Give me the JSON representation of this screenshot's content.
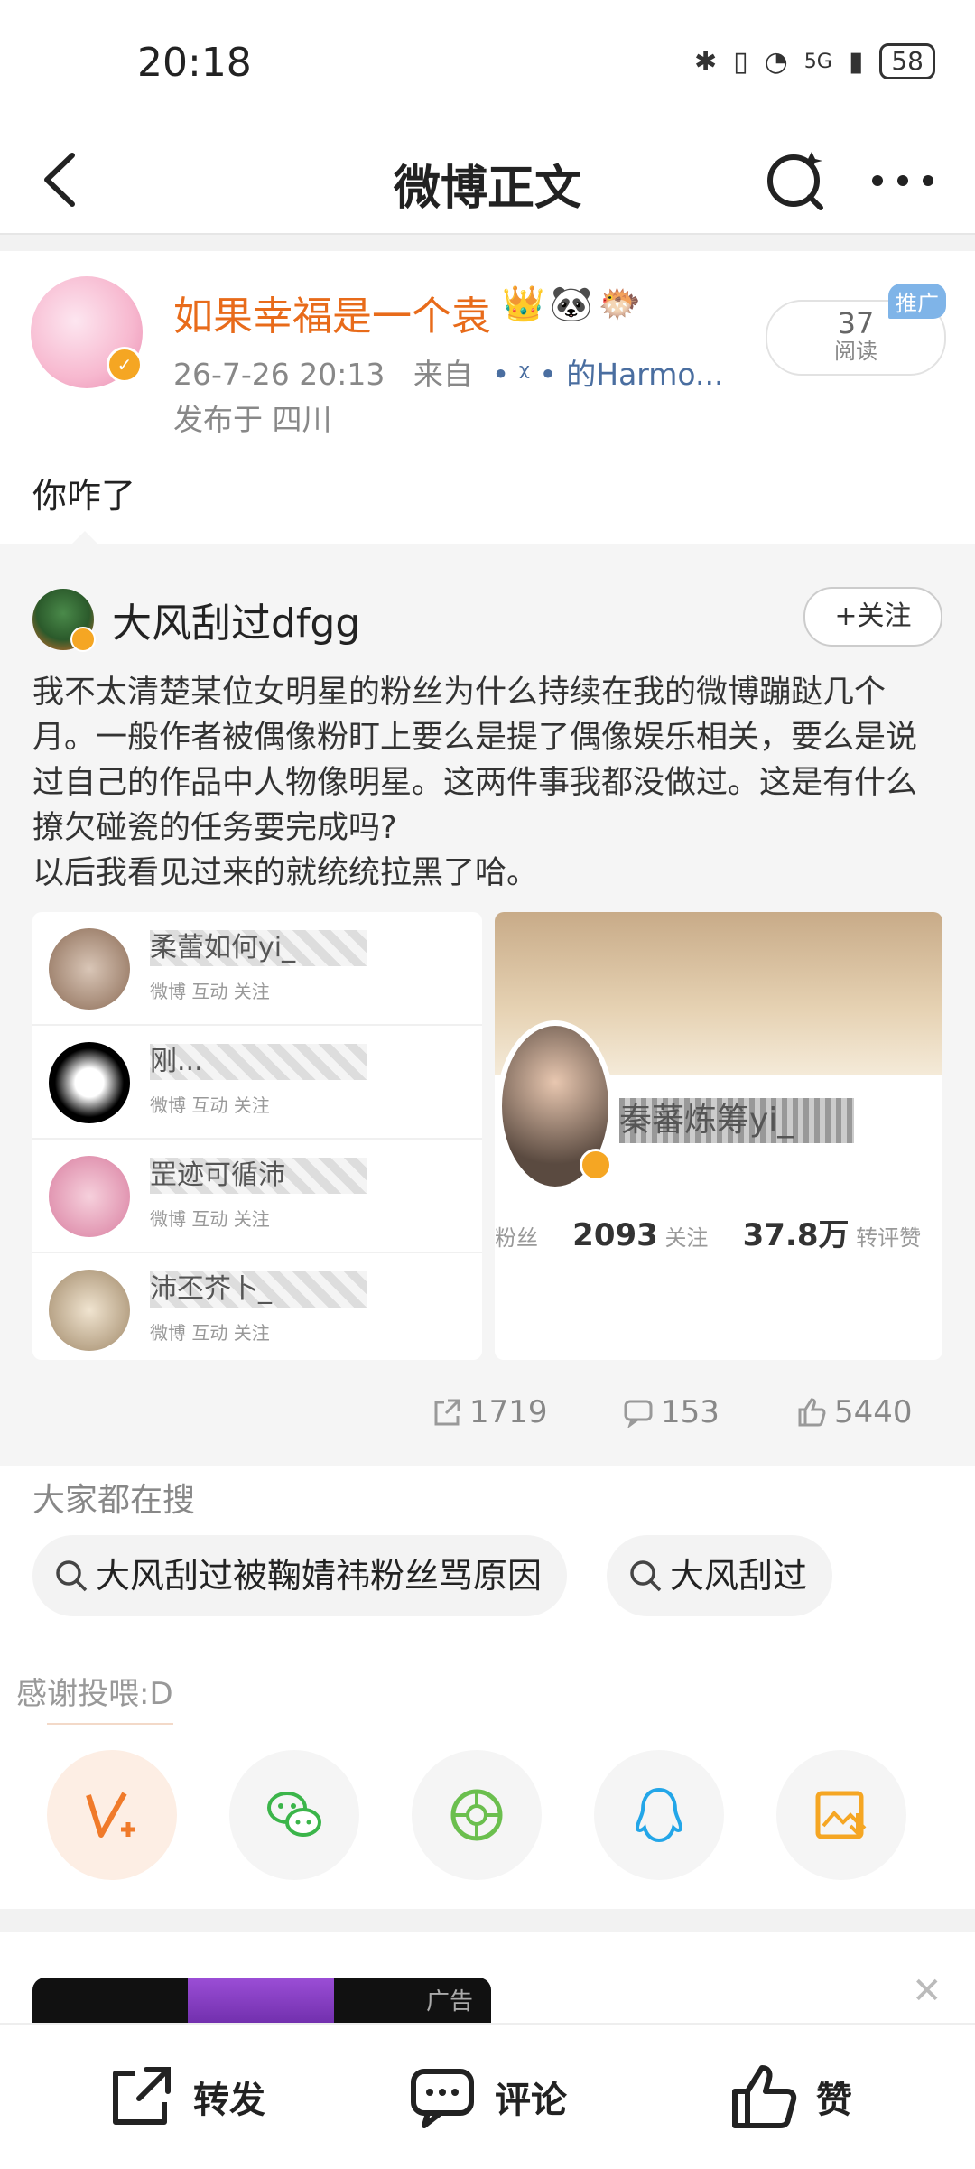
{
  "status_bar": {
    "time": "20:18",
    "network": "5G",
    "battery": "58"
  },
  "nav": {
    "title": "微博正文"
  },
  "post": {
    "username": "如果幸福是一个袁",
    "emojis": [
      "👑",
      "🐼",
      "🐡"
    ],
    "time": "26-7-26 20:13",
    "from_label": "来自",
    "source": "• ᵡ • 的Harmo...",
    "location": "发布于 四川",
    "read_count": "37",
    "read_label": "阅读",
    "ad_tag": "推广",
    "text": "你咋了"
  },
  "repost": {
    "username": "大风刮过dfgg",
    "follow_label": "+关注",
    "text_lines": [
      "我不太清楚某位女明星的粉丝为什么持续在我的微博蹦跶几个",
      "月。一般作者被偶像粉盯上要么是提了偶像娱乐相关，要么是说",
      "过自己的作品中人物像明星。这两件事我都没做过。这是有什么",
      "撩欠碰瓷的任务要完成吗?",
      "以后我看见过来的就统统拉黑了哈。"
    ],
    "image1_rows": [
      {
        "name": "柔蕾如何yi_",
        "sub": "微博 互动 关注"
      },
      {
        "name": "刚...",
        "sub": "微博 互动 关注"
      },
      {
        "name": "罡迹可循沛",
        "sub": "微博 互动 关注"
      },
      {
        "name": "沛丕芥卜_",
        "sub": "微博 互动 关注"
      }
    ],
    "image2": {
      "name": "秦蕃炼筹yi_",
      "stat_fans_label": "粉丝",
      "stat_follow_value": "2093",
      "stat_follow_label": "关注",
      "stat_likes_value": "37.8万",
      "stat_likes_label": "转评赞"
    },
    "reposts": "1719",
    "comments": "153",
    "likes": "5440"
  },
  "search": {
    "title": "大家都在搜",
    "chips": [
      "大风刮过被鞠婧祎粉丝骂原因",
      "大风刮过"
    ]
  },
  "share": {
    "title": "感谢投喂:D"
  },
  "ad": {
    "label": "广告"
  },
  "bottom": {
    "repost": "转发",
    "comment": "评论",
    "like": "赞"
  },
  "colors": {
    "username": "#e86b1a",
    "source": "#4a6ea0",
    "wechat": "#3bb54a",
    "moments": "#6bbf4e",
    "qq": "#23a6e8",
    "save": "#f5a623",
    "vplus": "#f07a2a"
  }
}
